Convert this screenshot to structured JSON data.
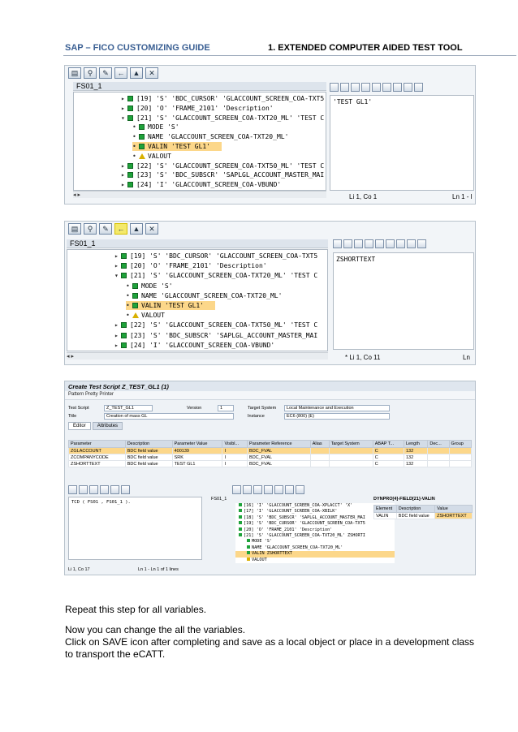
{
  "header": {
    "left": "SAP – FICO CUSTOMIZING GUIDE",
    "num": "1",
    "right": ". EXTENDED COMPUTER AIDED TEST TOOL"
  },
  "shot1": {
    "tree_title": "FS01_1",
    "rows": [
      {
        "kind": "node",
        "text": "[19]  'S' 'BDC_CURSOR' 'GLACCOUNT_SCREEN_COA-TXT5"
      },
      {
        "kind": "node",
        "text": "[20]  'O' 'FRAME_2101' 'Description'"
      },
      {
        "kind": "open",
        "text": "[21]  'S' 'GLACCOUNT_SCREEN_COA-TXT20_ML' 'TEST C"
      },
      {
        "kind": "leaf",
        "text": "MODE 'S'"
      },
      {
        "kind": "leaf",
        "text": "NAME 'GLACCOUNT_SCREEN_COA-TXT20_ML'"
      },
      {
        "kind": "sel",
        "text": "VALIN 'TEST GL1'"
      },
      {
        "kind": "warn",
        "text": "VALOUT"
      },
      {
        "kind": "node",
        "text": "[22]  'S' 'GLACCOUNT_SCREEN_COA-TXT50_ML' 'TEST C"
      },
      {
        "kind": "node",
        "text": "[23]  'S' 'BDC_SUBSCR' 'SAPLGL_ACCOUNT_MASTER_MAI"
      },
      {
        "kind": "node",
        "text": "[24]  'I' 'GLACCOUNT_SCREEN_COA-VBUND'"
      }
    ],
    "editor_text": "'TEST GL1'",
    "status_pos": "Li 1, Co 1",
    "status_line": "Ln 1 - l"
  },
  "shot2": {
    "tree_title": "FS01_1",
    "rows": [
      {
        "kind": "node",
        "text": "[19]  'S' 'BDC_CURSOR' 'GLACCOUNT_SCREEN_COA-TXT5"
      },
      {
        "kind": "node",
        "text": "[20]  'O' 'FRAME_2101' 'Description'"
      },
      {
        "kind": "open",
        "text": "[21]  'S' 'GLACCOUNT_SCREEN_COA-TXT20_ML' 'TEST C"
      },
      {
        "kind": "leaf",
        "text": "MODE 'S'"
      },
      {
        "kind": "leaf",
        "text": "NAME 'GLACCOUNT_SCREEN_COA-TXT20_ML'"
      },
      {
        "kind": "sel",
        "text": "VALIN 'TEST GL1'"
      },
      {
        "kind": "warn",
        "text": "VALOUT"
      },
      {
        "kind": "node",
        "text": "[22]  'S' 'GLACCOUNT_SCREEN_COA-TXT50_ML' 'TEST C"
      },
      {
        "kind": "node",
        "text": "[23]  'S' 'BDC_SUBSCR' 'SAPLGL_ACCOUNT_MASTER_MAI"
      },
      {
        "kind": "node",
        "text": "[24]  'I' 'GLACCOUNT_SCREEN_COA-VBUND'"
      }
    ],
    "editor_text": "ZSHORTTEXT",
    "status_pos": "*  Li 1, Co 11",
    "status_line": "Ln"
  },
  "ecatt": {
    "title": "Create Test Script Z_TEST_GL1 (1)",
    "toolbar": "Pattern    Pretty Printer",
    "test_script_label": "Test Script",
    "test_script": "Z_TEST_GL1",
    "version_label": "Version",
    "version": "1",
    "title_label": "Title",
    "title_value": "Creation of mass GL",
    "target_label": "Target System",
    "target_value": "Local Maintenance and Execution",
    "instance_label": "Instance",
    "instance_value": "EC6 (800) (E)",
    "tabs": [
      "Editor",
      "Attributes"
    ],
    "columns": [
      "Parameter",
      "Description",
      "Parameter Value",
      "Visibl...",
      "Parameter Reference",
      "Alias",
      "Target System",
      "ABAP T...",
      "Length",
      "Dec...",
      "Group"
    ],
    "params": [
      {
        "p": "ZGLACCOUNT",
        "d": "BDC field value",
        "v": "400139",
        "vis": "I",
        "ref": "BDC_FVAL",
        "abap": "C",
        "len": "132"
      },
      {
        "p": "ZCOMPANYCODE",
        "d": "BDC field value",
        "v": "SRK",
        "vis": "I",
        "ref": "BDC_FVAL",
        "abap": "C",
        "len": "132"
      },
      {
        "p": "ZSHORTTEXT",
        "d": "BDC field value",
        "v": "TEST GL1",
        "vis": "I",
        "ref": "BDC_FVAL",
        "abap": "C",
        "len": "132"
      }
    ],
    "cmd": "TCD ( FS01 , FS01_1 ).",
    "status_left": "Li 1, Co 17",
    "status_mid": "Ln 1 - Ln 1 of 1 lines",
    "mini_title": "FS01_1",
    "mini_rows": [
      {
        "k": "n",
        "t": "[16]  'I' 'GLACCOUNT_SCREEN_COA-XPLACCT' 'X'"
      },
      {
        "k": "n",
        "t": "[17]  'I' 'GLACCOUNT_SCREEN_COA-XBILK'"
      },
      {
        "k": "n",
        "t": "[18]  'S' 'BDC_SUBSCR' 'SAPLGL_ACCOUNT_MASTER_MAI"
      },
      {
        "k": "n",
        "t": "[19]  'S' 'BDC_CURSOR' 'GLACCOUNT_SCREEN_COA-TXT5"
      },
      {
        "k": "n",
        "t": "[20]  'O' 'FRAME_2101' 'Description'"
      },
      {
        "k": "o",
        "t": "[21]  'S' 'GLACCOUNT_SCREEN_COA-TXT20_ML' ZSHORTI"
      },
      {
        "k": "l",
        "t": "MODE 'S'"
      },
      {
        "k": "l",
        "t": "NAME 'GLACCOUNT_SCREEN_COA-TXT20_ML'"
      },
      {
        "k": "s",
        "t": "VALIN ZSHORTTEXT"
      },
      {
        "k": "w",
        "t": "VALOUT"
      }
    ],
    "dyn_title": "DYNPRO[4]-FIELD[21]-VALIN",
    "dyn_cols": [
      "Element",
      "Description",
      "Value"
    ],
    "dyn_row": {
      "e": "VALIN",
      "d": "BDC field value",
      "v": "ZSHORTTEXT"
    }
  },
  "body": {
    "p1": "Repeat this step for all variables.",
    "p2a": "Now you can change the all the variables.",
    "p2b": "Click on SAVE icon after completing and save as a local object or place in a development class",
    "p2c": "to transport the eCATT."
  }
}
